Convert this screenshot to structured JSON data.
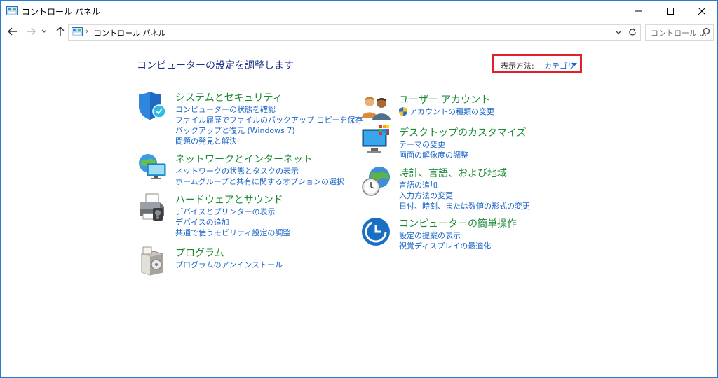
{
  "window": {
    "title": "コントロール パネル"
  },
  "address": {
    "crumb": "コントロール パネル",
    "search_placeholder": "コントロール ..."
  },
  "main": {
    "heading": "コンピューターの設定を調整します",
    "view_by": {
      "label": "表示方法:",
      "value": "カテゴリ"
    }
  },
  "categories": {
    "security": {
      "title": "システムとセキュリティ",
      "links": [
        "コンピューターの状態を確認",
        "ファイル履歴でファイルのバックアップ コピーを保存",
        "バックアップと復元 (Windows 7)",
        "問題の発見と解決"
      ]
    },
    "network": {
      "title": "ネットワークとインターネット",
      "links": [
        "ネットワークの状態とタスクの表示",
        "ホームグループと共有に関するオプションの選択"
      ]
    },
    "hardware": {
      "title": "ハードウェアとサウンド",
      "links": [
        "デバイスとプリンターの表示",
        "デバイスの追加",
        "共通で使うモビリティ設定の調整"
      ]
    },
    "programs": {
      "title": "プログラム",
      "links": [
        "プログラムのアンインストール"
      ]
    },
    "users": {
      "title": "ユーザー アカウント",
      "links": [
        "アカウントの種類の変更"
      ]
    },
    "appearance": {
      "title": "デスクトップのカスタマイズ",
      "links": [
        "テーマの変更",
        "画面の解像度の調整"
      ]
    },
    "clock": {
      "title": "時計、言語、および地域",
      "links": [
        "言語の追加",
        "入力方法の変更",
        "日付、時刻、または数値の形式の変更"
      ]
    },
    "ease": {
      "title": "コンピューターの簡単操作",
      "links": [
        "設定の提案の表示",
        "視覚ディスプレイの最適化"
      ]
    }
  },
  "colors": {
    "heading": "#1e3287",
    "category_title": "#1a8a35",
    "link": "#1a64c8",
    "highlight_box": "#e0202a"
  },
  "icons": [
    "control-panel-icon",
    "back-arrow-icon",
    "forward-arrow-icon",
    "recent-dropdown-icon",
    "up-arrow-icon",
    "refresh-icon",
    "search-icon",
    "minimize-icon",
    "maximize-icon",
    "close-icon",
    "shield-icon",
    "network-globe-icon",
    "printer-icon",
    "program-box-icon",
    "users-icon",
    "desktop-monitor-icon",
    "clock-globe-icon",
    "ease-of-access-icon",
    "uac-shield-icon"
  ]
}
